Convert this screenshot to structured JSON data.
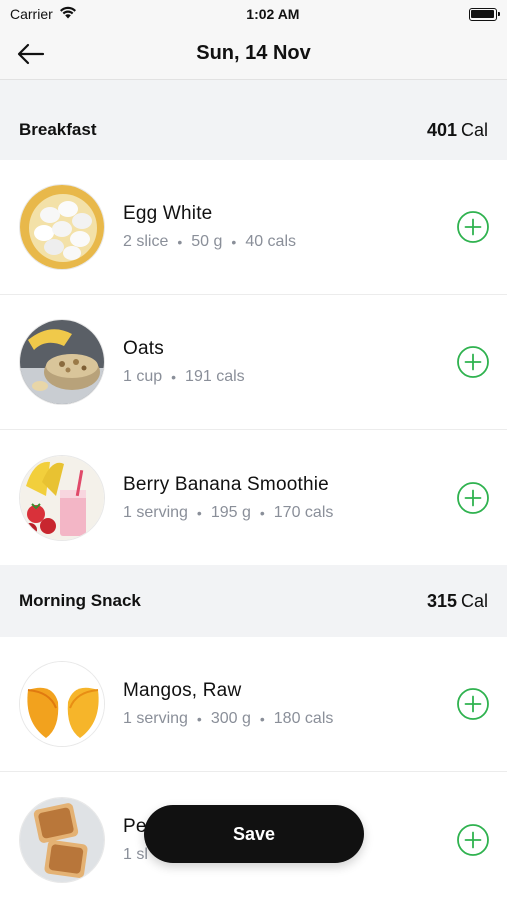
{
  "status_bar": {
    "carrier": "Carrier",
    "time": "1:02 AM"
  },
  "header": {
    "title": "Sun, 14 Nov"
  },
  "sections": [
    {
      "title": "Breakfast",
      "calories": "401",
      "calories_unit": "Cal",
      "items": [
        {
          "name": "Egg White",
          "quantity": "2 slice",
          "weight": "50 g",
          "calories": "40 cals"
        },
        {
          "name": "Oats",
          "quantity": "1 cup",
          "calories": "191 cals"
        },
        {
          "name": "Berry Banana Smoothie",
          "quantity": "1 serving",
          "weight": "195 g",
          "calories": "170 cals"
        }
      ]
    },
    {
      "title": "Morning Snack",
      "calories": "315",
      "calories_unit": "Cal",
      "items": [
        {
          "name": "Mangos, Raw",
          "quantity": "1 serving",
          "weight": "300 g",
          "calories": "180 cals"
        },
        {
          "name": "Pe",
          "quantity": "1 sl"
        }
      ]
    }
  ],
  "save_label": "Save",
  "colors": {
    "accent": "#2fb24f",
    "save_bg": "#111111",
    "section_bg": "#f2f3f5",
    "meta_text": "#8a8f99"
  },
  "icons": {
    "back": "arrow-left-icon",
    "add": "plus-circle-icon",
    "wifi": "wifi-icon",
    "battery": "battery-icon"
  }
}
